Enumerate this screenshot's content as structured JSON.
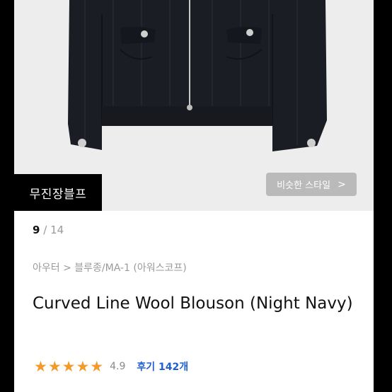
{
  "product": {
    "brand_badge": "무진장블프",
    "similar_style_label": "비슷한 스타일",
    "similar_style_chevron": ">",
    "image_index": "9",
    "image_separator": "/",
    "image_total": "14",
    "breadcrumb": "아우터 > 블루종/MA-1 (아워스코프)",
    "title": "Curved Line Wool Blouson (Night Navy)",
    "rating_stars": "★★★★★",
    "rating_value": "4.9",
    "review_label": "후기 142개"
  },
  "colors": {
    "accent_star": "#f39b2a",
    "review_link": "#1f5fd1",
    "jacket": "#1b1d25"
  }
}
